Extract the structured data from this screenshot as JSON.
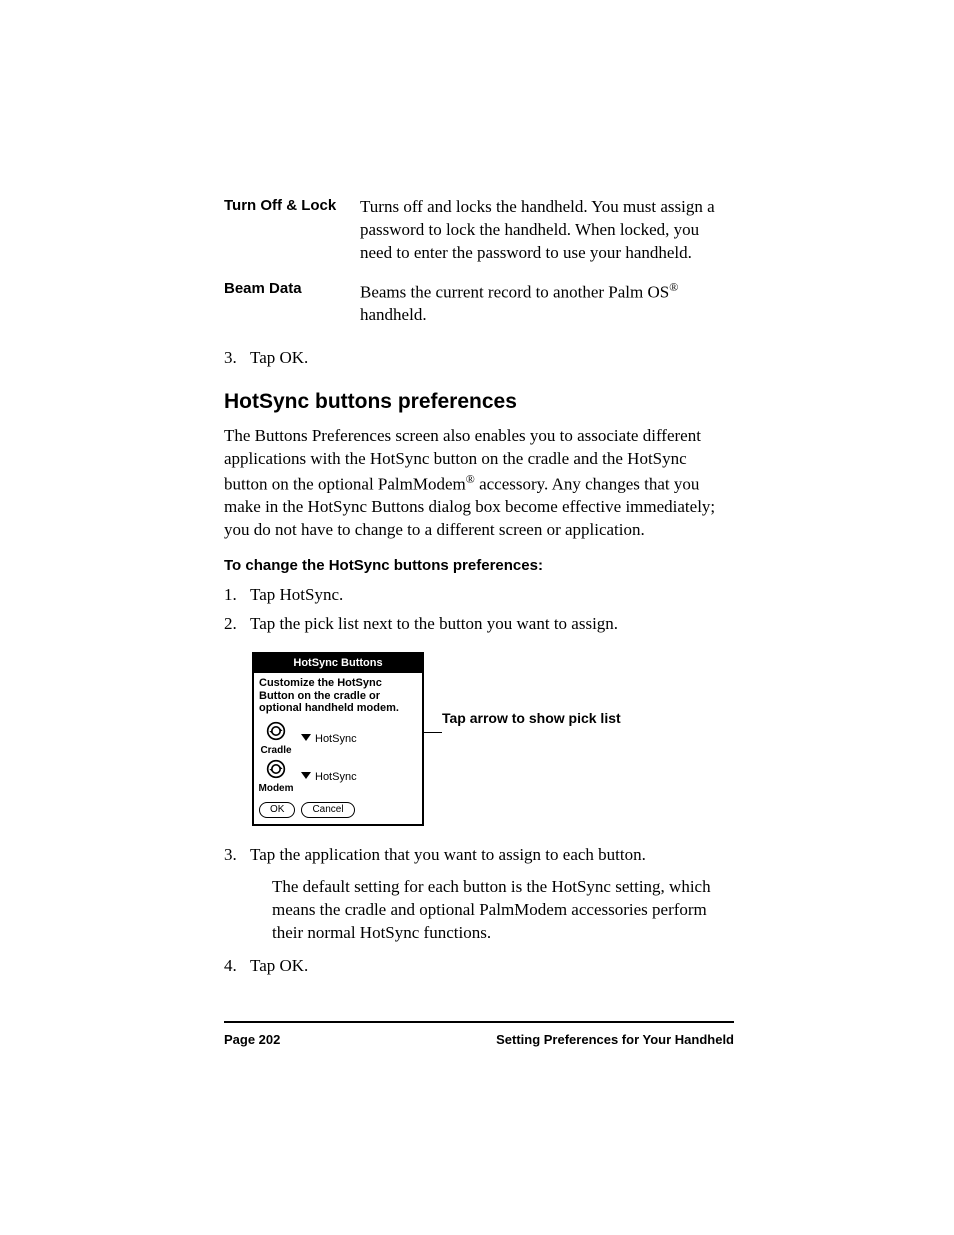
{
  "definitions": [
    {
      "term": "Turn Off & Lock",
      "desc": "Turns off and locks the handheld. You must assign a password to lock the handheld. When locked, you need to enter the password to use your handheld."
    },
    {
      "term": "Beam Data",
      "desc_pre": "Beams the current record to another Palm OS",
      "desc_post": " handheld."
    }
  ],
  "step3a": {
    "num": "3.",
    "text": "Tap OK."
  },
  "heading": "HotSync buttons preferences",
  "intro_pre": "The Buttons Preferences screen also enables you to associate different applications with the HotSync button on the cradle and the HotSync button on the optional PalmModem",
  "intro_post": " accessory. Any changes that you make in the HotSync Buttons dialog box become effective immediately; you do not have to change to a different screen or application.",
  "proc_heading": "To change the HotSync buttons preferences:",
  "steps": [
    {
      "num": "1.",
      "text": "Tap HotSync."
    },
    {
      "num": "2.",
      "text": "Tap the pick list next to the button you want to assign."
    }
  ],
  "dialog": {
    "title": "HotSync Buttons",
    "instruction": "Customize the HotSync Button on the cradle or optional handheld modem.",
    "rows": [
      {
        "label": "Cradle",
        "value": "HotSync"
      },
      {
        "label": "Modem",
        "value": "HotSync"
      }
    ],
    "ok": "OK",
    "cancel": "Cancel"
  },
  "callout": "Tap arrow to show pick list",
  "step3b": {
    "num": "3.",
    "text": "Tap the application that you want to assign to each button."
  },
  "step3b_sub": "The default setting for each button is the HotSync setting, which means the cradle and optional PalmModem accessories perform their normal HotSync functions.",
  "step4": {
    "num": "4.",
    "text": "Tap OK."
  },
  "footer": {
    "left": "Page 202",
    "right": "Setting Preferences for Your Handheld"
  }
}
